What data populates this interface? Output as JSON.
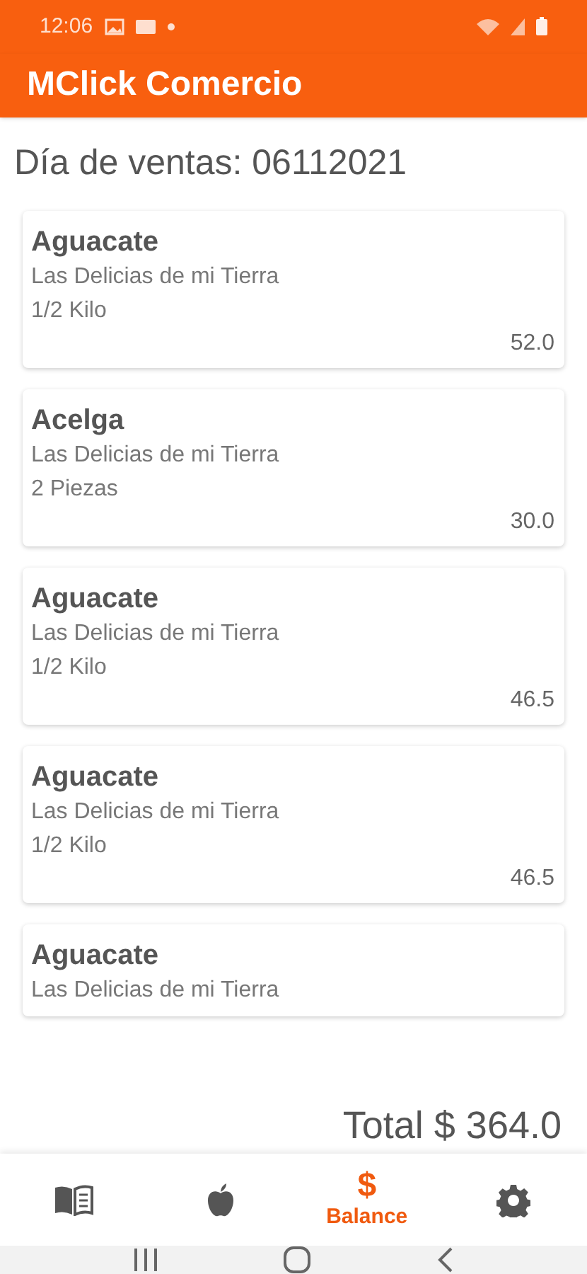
{
  "status_bar": {
    "time": "12:06"
  },
  "app_bar": {
    "title": "MClick Comercio"
  },
  "heading": "Día de ventas: 06112021",
  "sales": [
    {
      "product": "Aguacate",
      "vendor": "Las Delicias de mi Tierra",
      "quantity": "1/2 Kilo",
      "amount": "52.0"
    },
    {
      "product": "Acelga",
      "vendor": "Las Delicias de mi Tierra",
      "quantity": "2 Piezas",
      "amount": "30.0"
    },
    {
      "product": "Aguacate",
      "vendor": "Las Delicias de mi Tierra",
      "quantity": "1/2 Kilo",
      "amount": "46.5"
    },
    {
      "product": "Aguacate",
      "vendor": "Las Delicias de mi Tierra",
      "quantity": "1/2 Kilo",
      "amount": "46.5"
    },
    {
      "product": "Aguacate",
      "vendor": "Las Delicias de mi Tierra"
    }
  ],
  "total": "Total $ 364.0",
  "bottom_nav": [
    {
      "kind": "book",
      "selected": false
    },
    {
      "kind": "apple",
      "selected": false
    },
    {
      "kind": "dollar",
      "glyph": "$",
      "label": "Balance",
      "selected": true
    },
    {
      "kind": "gear",
      "selected": false
    }
  ]
}
